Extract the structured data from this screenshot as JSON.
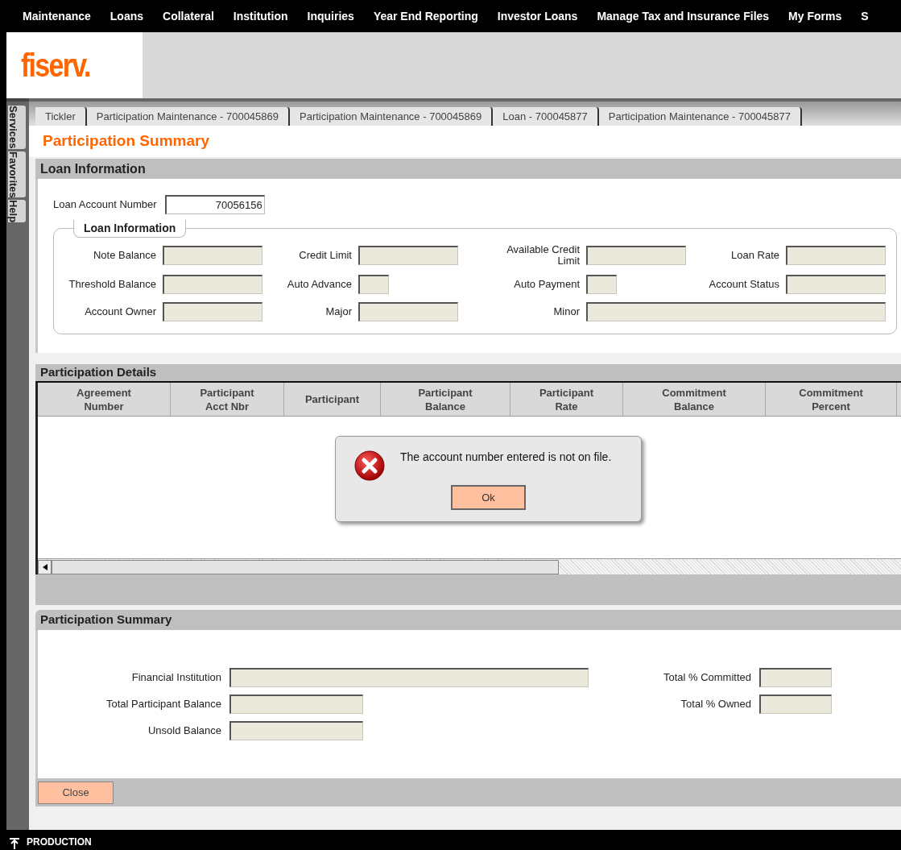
{
  "menu": [
    "Maintenance",
    "Loans",
    "Collateral",
    "Institution",
    "Inquiries",
    "Year End Reporting",
    "Investor Loans",
    "Manage Tax and Insurance Files",
    "My Forms",
    "S"
  ],
  "logo": "fiserv.",
  "side_tabs": [
    "Services",
    "Favorites",
    "Help"
  ],
  "tabs": [
    {
      "label": "Tickler",
      "selected": false
    },
    {
      "label": "Participation Maintenance - 700045869",
      "selected": false
    },
    {
      "label": "Participation Maintenance - 700045869",
      "selected": false
    },
    {
      "label": "Loan - 700045877",
      "selected": false
    },
    {
      "label": "Participation Maintenance - 700045877",
      "selected": false
    }
  ],
  "page_title": "Participation Summary",
  "loan_section": {
    "title": "Loan Information",
    "account_label": "Loan Account Number",
    "account_value": "70056156",
    "group_title": "Loan Information",
    "fields": [
      {
        "label": "Note Balance",
        "kind": "normal"
      },
      {
        "label": "Credit Limit",
        "kind": "normal"
      },
      {
        "label": "Available Credit Limit",
        "kind": "normal"
      },
      {
        "label": "Loan Rate",
        "kind": "normal"
      },
      {
        "label": "Threshold Balance",
        "kind": "normal"
      },
      {
        "label": "Auto Advance",
        "kind": "short"
      },
      {
        "label": "Auto Payment",
        "kind": "short"
      },
      {
        "label": "Account Status",
        "kind": "normal"
      },
      {
        "label": "Account Owner",
        "kind": "normal"
      },
      {
        "label": "Major",
        "kind": "normal"
      },
      {
        "label": "Minor",
        "kind": "wide"
      }
    ]
  },
  "details": {
    "title": "Participation Details",
    "columns": [
      {
        "lines": [
          "Agreement",
          "Number"
        ]
      },
      {
        "lines": [
          "Participant",
          "Acct Nbr"
        ]
      },
      {
        "lines": [
          "Participant"
        ]
      },
      {
        "lines": [
          "Participant",
          "Balance"
        ]
      },
      {
        "lines": [
          "Participant",
          "Rate"
        ]
      },
      {
        "lines": [
          "Commitment",
          "Balance"
        ]
      },
      {
        "lines": [
          "Commitment",
          "Percent"
        ]
      }
    ]
  },
  "dialog": {
    "message": "The account number entered is not on file.",
    "button": "Ok"
  },
  "summary": {
    "title": "Participation Summary",
    "left_fields": [
      {
        "label": "Financial Institution",
        "kind": "wide"
      },
      {
        "label": "Total Participant Balance",
        "kind": "normal"
      },
      {
        "label": "Unsold Balance",
        "kind": "normal"
      }
    ],
    "right_fields": [
      {
        "label": "Total % Committed"
      },
      {
        "label": "Total % Owned"
      }
    ]
  },
  "close_button": "Close",
  "status_bar": "PRODUCTION"
}
